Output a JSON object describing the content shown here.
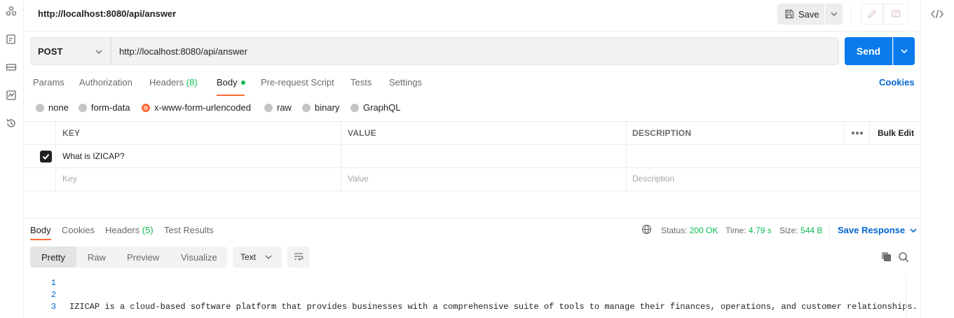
{
  "header": {
    "url_title": "http://localhost:8080/api/answer",
    "save_label": "Save"
  },
  "request": {
    "method": "POST",
    "url": "http://localhost:8080/api/answer",
    "send_label": "Send"
  },
  "request_tabs": {
    "params": "Params",
    "authorization": "Authorization",
    "headers": "Headers",
    "headers_count": "(8)",
    "body": "Body",
    "pre_request_script": "Pre-request Script",
    "tests": "Tests",
    "settings": "Settings",
    "cookies": "Cookies",
    "active": "Body"
  },
  "body_types": {
    "none": "none",
    "form_data": "form-data",
    "urlencoded": "x-www-form-urlencoded",
    "raw": "raw",
    "binary": "binary",
    "graphql": "GraphQL",
    "selected": "x-www-form-urlencoded"
  },
  "params_table": {
    "columns": {
      "key": "KEY",
      "value": "VALUE",
      "description": "DESCRIPTION"
    },
    "bulk_edit": "Bulk Edit",
    "rows": [
      {
        "checked": true,
        "key": "What is IZICAP?",
        "value": "",
        "description": ""
      }
    ],
    "placeholders": {
      "key": "Key",
      "value": "Value",
      "description": "Description"
    }
  },
  "response": {
    "tabs": {
      "body": "Body",
      "cookies": "Cookies",
      "headers": "Headers",
      "headers_count": "(5)",
      "test_results": "Test Results"
    },
    "status_label": "Status:",
    "status_value": "200 OK",
    "time_label": "Time:",
    "time_value": "4.79 s",
    "size_label": "Size:",
    "size_value": "544 B",
    "save_response": "Save Response",
    "formats": {
      "pretty": "Pretty",
      "raw": "Raw",
      "preview": "Preview",
      "visualize": "Visualize",
      "active": "Pretty"
    },
    "language": "Text",
    "lines": {
      "n1": "1",
      "n2": "2",
      "n3": "3",
      "line3": "IZICAP is a cloud-based software platform that provides businesses with a comprehensive suite of tools to manage their finances, operations, and customer relationships."
    }
  },
  "colors": {
    "accent": "#ff6c37",
    "primary": "#097bed",
    "link": "#0265d2",
    "success": "#0cbb52"
  }
}
